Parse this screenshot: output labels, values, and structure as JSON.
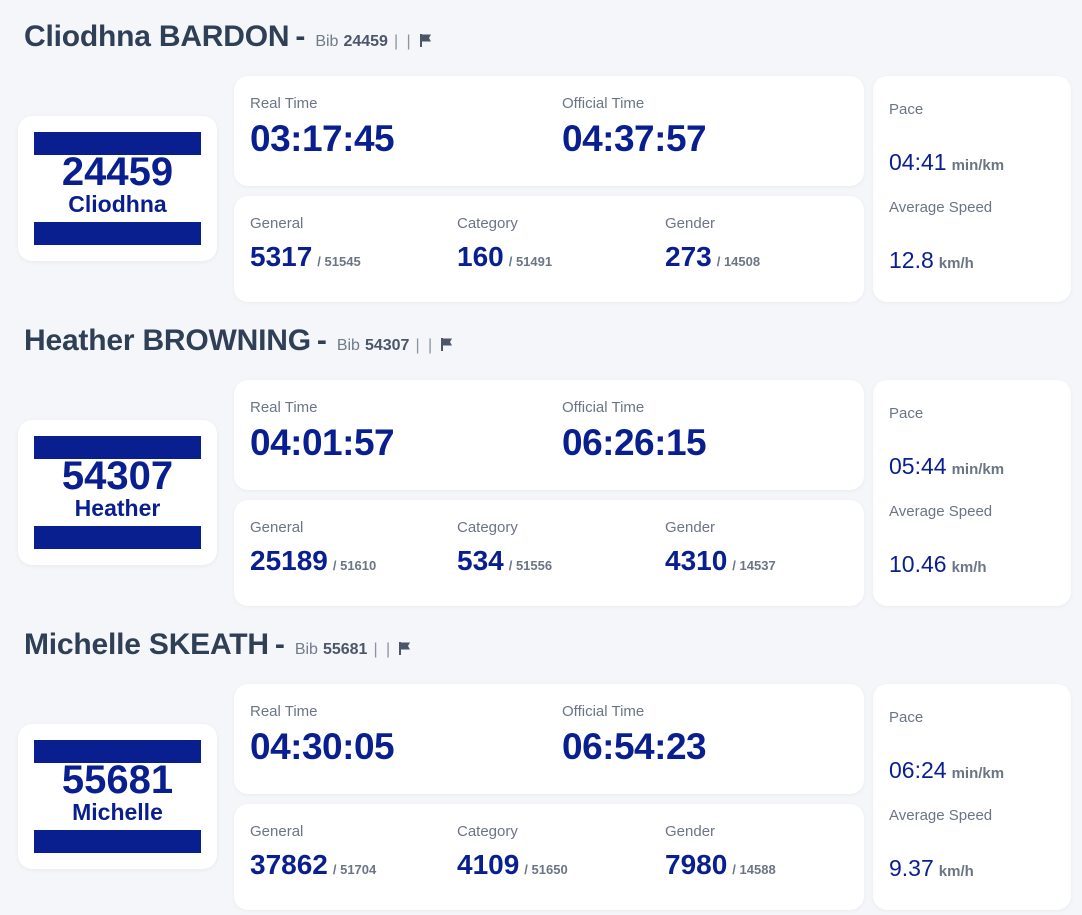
{
  "labels": {
    "bib": "Bib",
    "pipes": "| |",
    "real_time": "Real Time",
    "official_time": "Official Time",
    "general": "General",
    "category": "Category",
    "gender": "Gender",
    "pace": "Pace",
    "average_speed": "Average Speed",
    "pace_unit": "min/km",
    "speed_unit": "km/h"
  },
  "icons": {
    "flag": "flag-icon"
  },
  "colors": {
    "accent": "#0a1f8f",
    "heading": "#2f3f55",
    "muted": "#6b7585",
    "background": "#f4f6f9"
  },
  "runners": [
    {
      "full_name": "Cliodhna BARDON",
      "dash": "-",
      "bib": "24459",
      "first_name": "Cliodhna",
      "real_time": "03:17:45",
      "official_time": "04:37:57",
      "general": {
        "rank": "5317",
        "total": "/ 51545"
      },
      "category": {
        "rank": "160",
        "total": "/ 51491"
      },
      "gender": {
        "rank": "273",
        "total": "/ 14508"
      },
      "pace": "04:41",
      "average_speed": "12.8"
    },
    {
      "full_name": "Heather BROWNING",
      "dash": "-",
      "bib": "54307",
      "first_name": "Heather",
      "real_time": "04:01:57",
      "official_time": "06:26:15",
      "general": {
        "rank": "25189",
        "total": "/ 51610"
      },
      "category": {
        "rank": "534",
        "total": "/ 51556"
      },
      "gender": {
        "rank": "4310",
        "total": "/ 14537"
      },
      "pace": "05:44",
      "average_speed": "10.46"
    },
    {
      "full_name": "Michelle SKEATH",
      "dash": "-",
      "bib": "55681",
      "first_name": "Michelle",
      "real_time": "04:30:05",
      "official_time": "06:54:23",
      "general": {
        "rank": "37862",
        "total": "/ 51704"
      },
      "category": {
        "rank": "4109",
        "total": "/ 51650"
      },
      "gender": {
        "rank": "7980",
        "total": "/ 14588"
      },
      "pace": "06:24",
      "average_speed": "9.37"
    }
  ]
}
